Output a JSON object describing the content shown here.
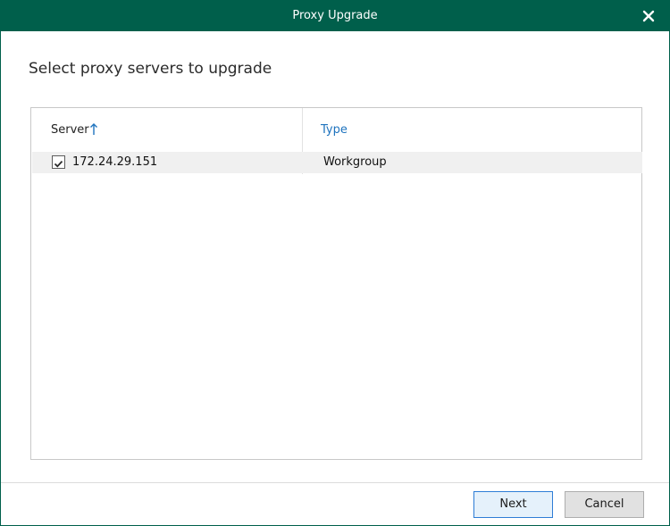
{
  "window": {
    "title": "Proxy Upgrade",
    "close_icon": "close-icon"
  },
  "heading": "Select proxy servers to upgrade",
  "grid": {
    "columns": [
      {
        "label": "Server",
        "sort": "ascending",
        "sort_icon": "arrow-up-icon"
      },
      {
        "label": "Type",
        "color": "#1e73be"
      }
    ],
    "rows": [
      {
        "checked": true,
        "server": "172.24.29.151",
        "type": "Workgroup"
      }
    ]
  },
  "buttons": {
    "next": "Next",
    "cancel": "Cancel"
  },
  "colors": {
    "titlebar": "#005f4b",
    "link": "#1e73be"
  }
}
